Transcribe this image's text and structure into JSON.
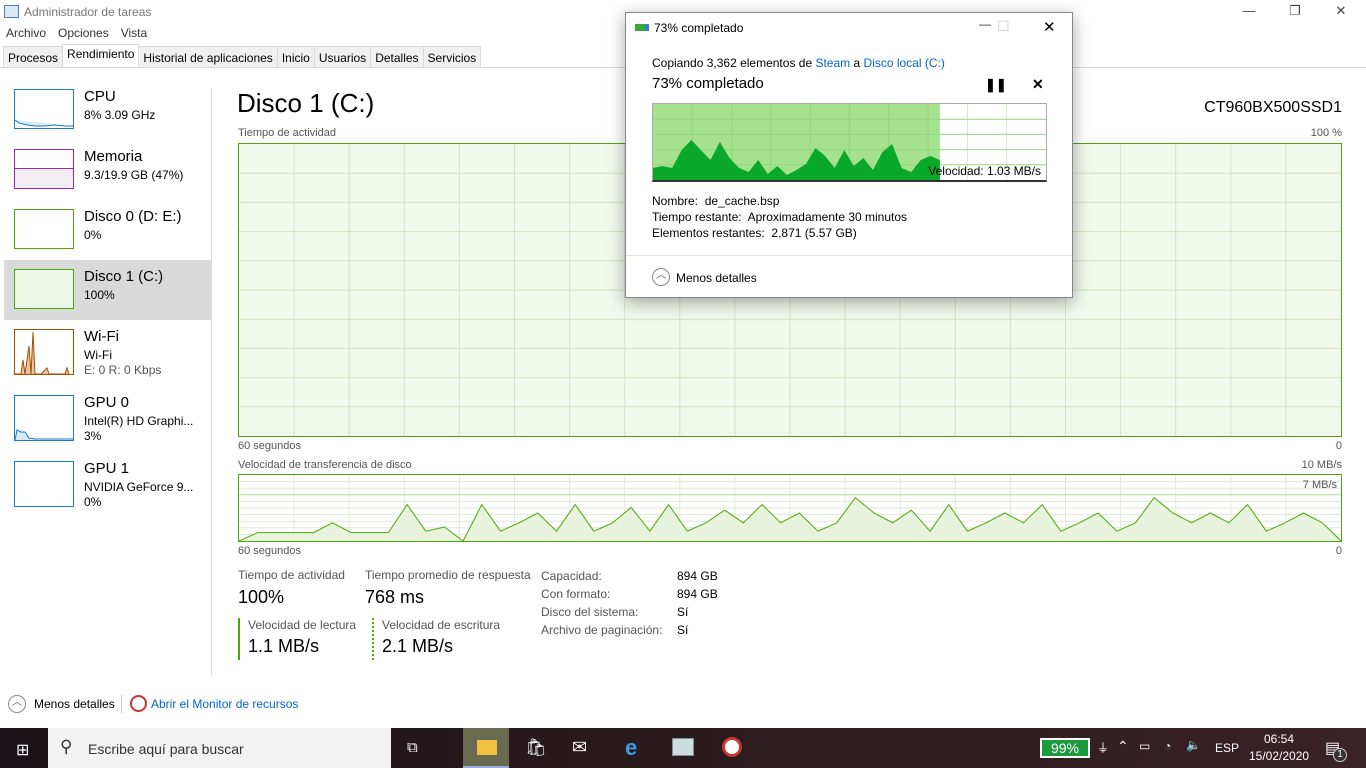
{
  "window": {
    "title": "Administrador de tareas",
    "menu": [
      "Archivo",
      "Opciones",
      "Vista"
    ],
    "tabs": [
      "Procesos",
      "Rendimiento",
      "Historial de aplicaciones",
      "Inicio",
      "Usuarios",
      "Detalles",
      "Servicios"
    ],
    "active_tab": "Rendimiento"
  },
  "sidebar": [
    {
      "name": "CPU",
      "sub": "8%  3.09 GHz",
      "color": "#1a7dbf"
    },
    {
      "name": "Memoria",
      "sub": "9.3/19.9 GB (47%)",
      "color": "#9528b4"
    },
    {
      "name": "Disco 0 (D: E:)",
      "sub": "0%",
      "color": "#4da60c"
    },
    {
      "name": "Disco 1 (C:)",
      "sub": "100%",
      "color": "#4da60c",
      "selected": true
    },
    {
      "name": "Wi-Fi",
      "sub": "Wi-Fi",
      "sub2": "E: 0 R: 0 Kbps",
      "color": "#a74f01"
    },
    {
      "name": "GPU 0",
      "sub": "Intel(R) HD Graphi...",
      "sub2": "3%",
      "color": "#1a7dbf"
    },
    {
      "name": "GPU 1",
      "sub": "NVIDIA GeForce 9...",
      "sub2": "0%",
      "color": "#1a7dbf"
    }
  ],
  "main": {
    "title": "Disco 1 (C:)",
    "model": "CT960BX500SSD1",
    "activity": {
      "label": "Tiempo de actividad",
      "max": "100 %",
      "left": "60 segundos",
      "right": "0",
      "value_pct": 100
    },
    "transfer": {
      "label": "Velocidad de transferencia de disco",
      "max": "10 MB/s",
      "mid": "7 MB/s",
      "left": "60 segundos",
      "right": "0"
    },
    "stats": {
      "activity_label": "Tiempo de actividad",
      "activity_value": "100%",
      "response_label": "Tiempo promedio de respuesta",
      "response_value": "768 ms",
      "read_label": "Velocidad de lectura",
      "read_value": "1.1 MB/s",
      "write_label": "Velocidad de escritura",
      "write_value": "2.1 MB/s"
    },
    "props": [
      [
        "Capacidad:",
        "894 GB"
      ],
      [
        "Con formato:",
        "894 GB"
      ],
      [
        "Disco del sistema:",
        "Sí"
      ],
      [
        "Archivo de paginación:",
        "Sí"
      ]
    ]
  },
  "bottom": {
    "less": "Menos detalles",
    "monitor": "Abrir el Monitor de recursos"
  },
  "dialog": {
    "title": "73% completado",
    "copy_prefix": "Copiando 3,362 elementos de ",
    "source": "Steam",
    "middle": " a ",
    "dest": "Disco local (C:)",
    "heading": "73% completado",
    "progress_pct": 73,
    "speed": "Velocidad: 1.03 MB/s",
    "name_label": "Nombre:",
    "name": "de_cache.bsp",
    "time_label": "Tiempo restante:",
    "time": "Aproximadamente 30 minutos",
    "items_label": "Elementos restantes:",
    "items": "2,871 (5.57 GB)",
    "less": "Menos detalles"
  },
  "taskbar": {
    "search": "Escribe aquí para buscar",
    "battery": "99%",
    "lang": "ESP",
    "time": "06:54",
    "date": "15/02/2020",
    "notifications": "1"
  }
}
